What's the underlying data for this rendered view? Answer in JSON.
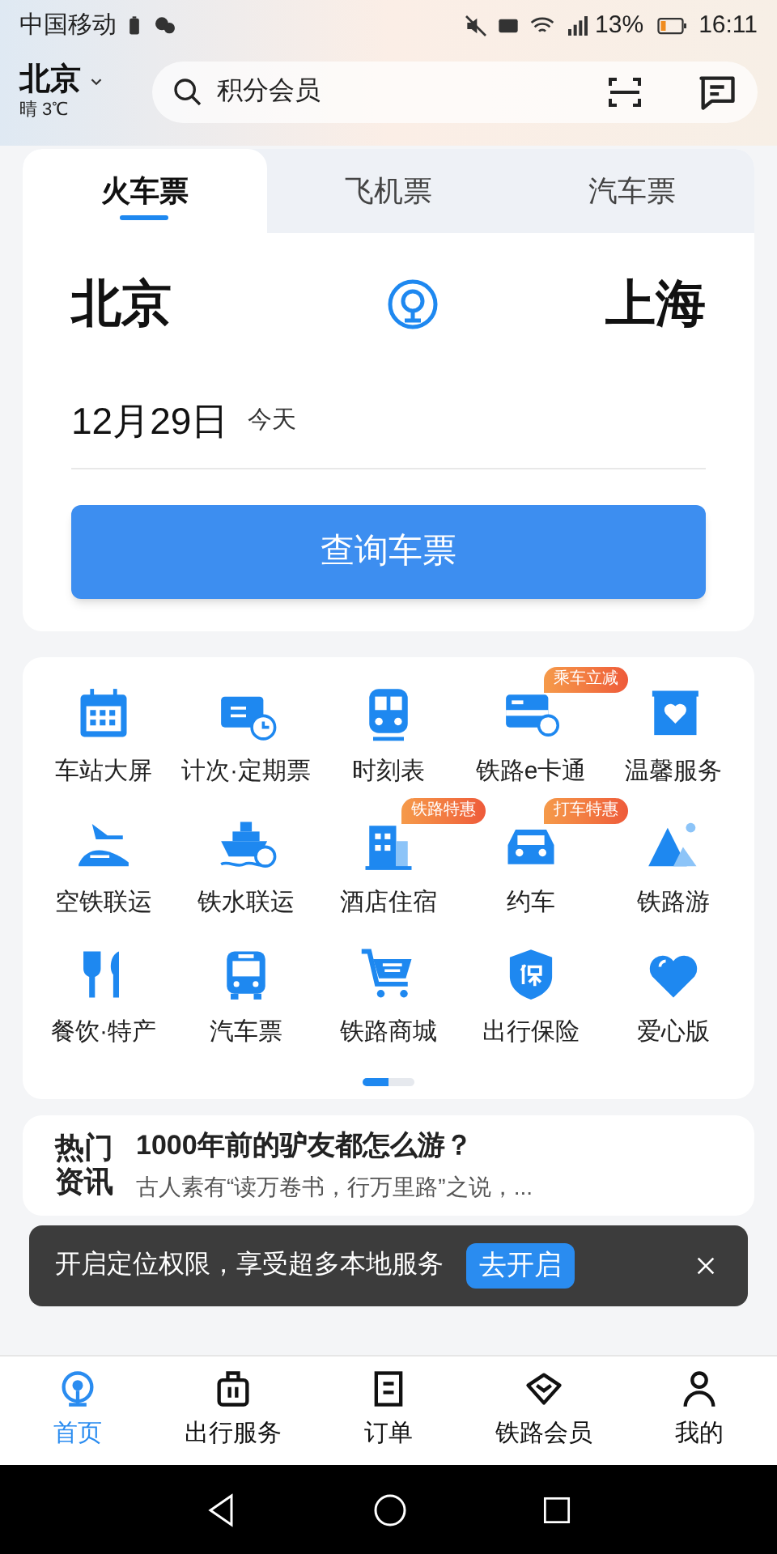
{
  "status_bar": {
    "carrier": "中国移动",
    "battery": "13%",
    "time": "16:11"
  },
  "header": {
    "city": "北京",
    "weather": "晴 3℃",
    "search": {
      "placeholder": "积分会员"
    }
  },
  "ticket_tabs": [
    {
      "label": "火车票",
      "selected": true
    },
    {
      "label": "飞机票",
      "selected": false
    },
    {
      "label": "汽车票",
      "selected": false
    }
  ],
  "route": {
    "from": "北京",
    "to": "上海"
  },
  "date": {
    "value": "12月29日",
    "note": "今天"
  },
  "search_button": "查询车票",
  "services": [
    {
      "label": "车站大屏"
    },
    {
      "label": "计次·定期票"
    },
    {
      "label": "时刻表"
    },
    {
      "label": "铁路e卡通",
      "badge": "乘车立减"
    },
    {
      "label": "温馨服务"
    },
    {
      "label": "空铁联运"
    },
    {
      "label": "铁水联运"
    },
    {
      "label": "酒店住宿",
      "badge": "铁路特惠"
    },
    {
      "label": "约车",
      "badge": "打车特惠"
    },
    {
      "label": "铁路游"
    },
    {
      "label": "餐饮·特产"
    },
    {
      "label": "汽车票"
    },
    {
      "label": "铁路商城"
    },
    {
      "label": "出行保险"
    },
    {
      "label": "爱心版"
    }
  ],
  "pages": [
    {
      "selected": true
    },
    {
      "selected": false
    }
  ],
  "news": {
    "section": "热门资讯",
    "title": "1000年前的驴友都怎么游？",
    "summary": "古人素有“读万卷书，行万里路”之说，..."
  },
  "toast": {
    "message": "开启定位权限，享受超多本地服务",
    "action": "去开启"
  },
  "bottom_nav": [
    {
      "label": "首页",
      "selected": true
    },
    {
      "label": "出行服务",
      "selected": false
    },
    {
      "label": "订单",
      "selected": false
    },
    {
      "label": "铁路会员",
      "selected": false
    },
    {
      "label": "我的",
      "selected": false
    }
  ]
}
